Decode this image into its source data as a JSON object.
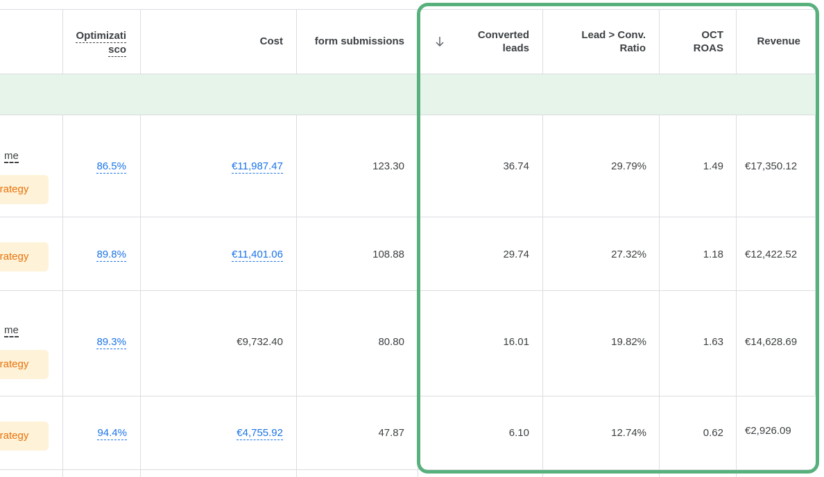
{
  "headers": {
    "optimization": [
      "Optimizati",
      "sco"
    ],
    "cost": "Cost",
    "form_submissions": "form submissions",
    "converted_leads": [
      "Converted",
      "leads"
    ],
    "lead_conv_ratio": [
      "Lead > Conv.",
      "Ratio"
    ],
    "oct_roas": [
      "OCT",
      "ROAS"
    ],
    "revenue": "Revenue"
  },
  "rows": [
    {
      "name_fragment": "me",
      "chip": "strategy",
      "optimization": "86.5%",
      "cost": "€11,987.47",
      "form_submissions": "123.30",
      "converted_leads": "36.74",
      "lead_conv_ratio": "29.79%",
      "oct_roas": "1.49",
      "revenue": "€17,350.12"
    },
    {
      "name_fragment": "",
      "chip": "strategy",
      "optimization": "89.8%",
      "cost": "€11,401.06",
      "form_submissions": "108.88",
      "converted_leads": "29.74",
      "lead_conv_ratio": "27.32%",
      "oct_roas": "1.18",
      "revenue": "€12,422.52"
    },
    {
      "name_fragment": "me",
      "chip": "strategy",
      "optimization": "89.3%",
      "cost": "€9,732.40",
      "form_submissions": "80.80",
      "converted_leads": "16.01",
      "lead_conv_ratio": "19.82%",
      "oct_roas": "1.63",
      "revenue": "€14,628.69"
    },
    {
      "name_fragment": "",
      "chip": "strategy",
      "optimization": "94.4%",
      "cost": "€4,755.92",
      "form_submissions": "47.87",
      "converted_leads": "6.10",
      "lead_conv_ratio": "12.74%",
      "oct_roas": "0.62",
      "revenue": "€2,926.09"
    }
  ],
  "sort_icon": "arrow-down-icon",
  "highlight_color": "#58b07d",
  "band_color": "#e6f4ea",
  "link_color": "#1a73e8",
  "chip_bg": "#fef3d9",
  "chip_text_color": "#e8710a"
}
